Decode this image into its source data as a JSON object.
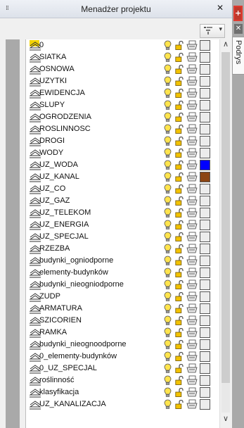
{
  "palette": {
    "title": "Menadżer projektu",
    "grip": "⁞⁞",
    "close_glyph": "✕"
  },
  "side": {
    "plus_glyph": "+",
    "close_glyph": "✕",
    "tab_label": "Podrys"
  },
  "scrollbar": {
    "up": "∧",
    "down": "∨"
  },
  "layers": [
    {
      "name": "0",
      "color": "#ffffff",
      "current": true
    },
    {
      "name": "SIATKA",
      "color": "#ffffff"
    },
    {
      "name": "OSNOWA",
      "color": "#ffffff"
    },
    {
      "name": "UZYTKI",
      "color": "#ffffff"
    },
    {
      "name": "EWIDENCJA",
      "color": "#ffffff"
    },
    {
      "name": "SLUPY",
      "color": "#ffffff"
    },
    {
      "name": "OGRODZENIA",
      "color": "#ffffff"
    },
    {
      "name": "ROSLINNOSC",
      "color": "#ffffff"
    },
    {
      "name": "DROGI",
      "color": "#ffffff"
    },
    {
      "name": "WODY",
      "color": "#ffffff"
    },
    {
      "name": "UZ_WODA",
      "color": "#0000ff"
    },
    {
      "name": "UZ_KANAL",
      "color": "#8b4513"
    },
    {
      "name": "UZ_CO",
      "color": "#ffffff"
    },
    {
      "name": "UZ_GAZ",
      "color": "#ffffff"
    },
    {
      "name": "UZ_TELEKOM",
      "color": "#ffffff"
    },
    {
      "name": "UZ_ENERGIA",
      "color": "#ffffff"
    },
    {
      "name": "UZ_SPECJAL",
      "color": "#ffffff"
    },
    {
      "name": "RZEZBA",
      "color": "#ffffff"
    },
    {
      "name": "budynki_ogniodporne",
      "color": "#ffffff"
    },
    {
      "name": "elementy-budynków",
      "color": "#ffffff"
    },
    {
      "name": "budynki_nieogniodporne",
      "color": "#ffffff"
    },
    {
      "name": "ZUDP",
      "color": "#ffffff"
    },
    {
      "name": "ARMATURA",
      "color": "#ffffff"
    },
    {
      "name": "SZICORIEN",
      "color": "#ffffff"
    },
    {
      "name": "RAMKA",
      "color": "#ffffff"
    },
    {
      "name": "budynki_nieognoodporne",
      "color": "#ffffff"
    },
    {
      "name": "0_elementy-budynków",
      "color": "#ffffff"
    },
    {
      "name": "0_UZ_SPECJAL",
      "color": "#ffffff"
    },
    {
      "name": "roślinność",
      "color": "#ffffff"
    },
    {
      "name": "klasyfikacja",
      "color": "#ffffff"
    },
    {
      "name": "UZ_KANALIZACJA",
      "color": "#ffffff"
    }
  ]
}
